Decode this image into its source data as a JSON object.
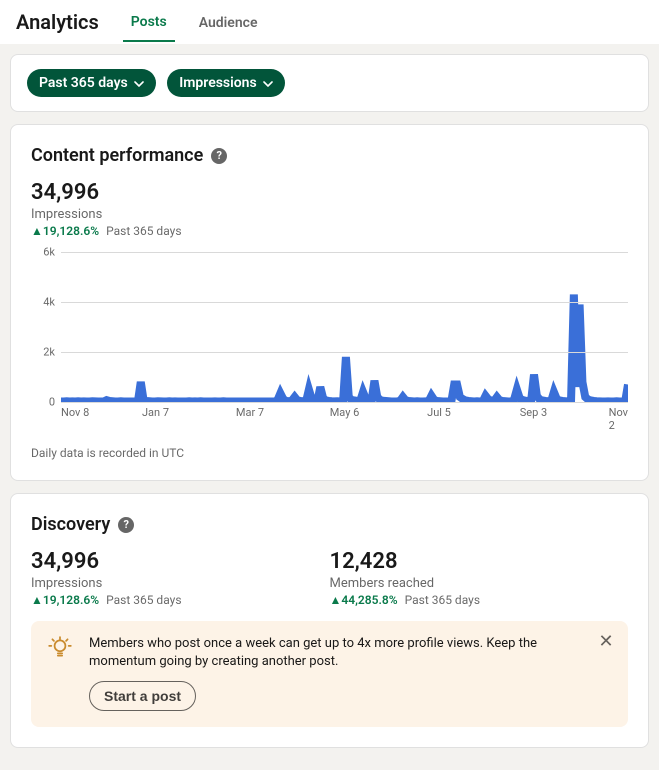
{
  "header": {
    "title": "Analytics",
    "tabs": [
      "Posts",
      "Audience"
    ],
    "active_tab": 0
  },
  "filters": {
    "date_range": "Past 365 days",
    "metric": "Impressions"
  },
  "performance": {
    "title": "Content performance",
    "value": "34,996",
    "label": "Impressions",
    "delta": "19,128.6%",
    "period": "Past 365 days",
    "note": "Daily data is recorded in UTC"
  },
  "discovery": {
    "title": "Discovery",
    "stats": [
      {
        "value": "34,996",
        "label": "Impressions",
        "delta": "19,128.6%",
        "period": "Past 365 days"
      },
      {
        "value": "12,428",
        "label": "Members reached",
        "delta": "44,285.8%",
        "period": "Past 365 days"
      }
    ],
    "tip": {
      "text": "Members who post once a week can get up to 4x more profile views. Keep the momentum going by creating another post.",
      "cta": "Start a post"
    }
  },
  "chart_data": {
    "type": "line",
    "title": "Content performance — Impressions",
    "xlabel": "",
    "ylabel": "",
    "ylim": [
      0,
      6000
    ],
    "y_ticks": [
      0,
      2000,
      4000,
      6000
    ],
    "y_tick_labels": [
      "0",
      "2k",
      "4k",
      "6k"
    ],
    "x_tick_labels": [
      "Nov 8",
      "Jan 7",
      "Mar 7",
      "May 6",
      "Jul 5",
      "Sep 3",
      "Nov 2"
    ],
    "values": [
      20,
      20,
      30,
      20,
      25,
      20,
      30,
      20,
      25,
      20,
      20,
      30,
      25,
      20,
      20,
      20,
      75,
      40,
      30,
      20,
      20,
      30,
      20,
      20,
      20,
      20,
      25,
      20,
      800,
      60,
      40,
      30,
      20,
      20,
      30,
      25,
      20,
      20,
      30,
      20,
      25,
      20,
      20,
      20,
      20,
      30,
      20,
      25,
      20,
      30,
      20,
      20,
      20,
      20,
      25,
      20,
      20,
      30,
      20,
      20,
      20,
      20,
      20,
      20,
      20,
      20,
      20,
      20,
      20,
      20,
      20,
      20,
      20,
      20,
      20,
      20,
      80,
      350,
      120,
      40,
      30,
      50,
      200,
      60,
      40,
      30,
      20,
      500,
      120,
      60,
      40,
      600,
      150,
      60,
      40,
      30,
      25,
      30,
      20,
      20,
      1800,
      200,
      80,
      60,
      40,
      30,
      400,
      120,
      60,
      40,
      850,
      200,
      80,
      50,
      40,
      30,
      20,
      20,
      25,
      40,
      200,
      60,
      40,
      30,
      20,
      30,
      20,
      20,
      25,
      20,
      250,
      80,
      40,
      30,
      20,
      20,
      25,
      20,
      700,
      700,
      200,
      120,
      60,
      40,
      30,
      20,
      30,
      20,
      20,
      250,
      100,
      60,
      40,
      200,
      60,
      40,
      30,
      20,
      20,
      90,
      500,
      150,
      80,
      50,
      40,
      30,
      1100,
      250,
      100,
      60,
      40,
      30,
      20,
      400,
      120,
      60,
      40,
      30,
      20,
      20,
      4300,
      600,
      3900,
      800,
      200,
      100,
      60,
      40,
      30,
      25,
      20,
      20,
      25,
      20,
      20,
      30,
      20,
      20,
      25,
      700
    ]
  }
}
